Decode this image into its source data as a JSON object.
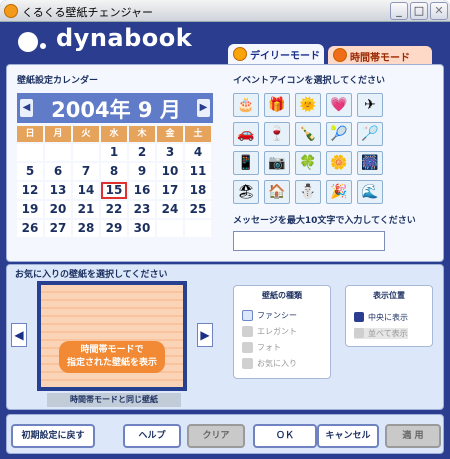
{
  "window": {
    "title": "くるくる壁紙チェンジャー",
    "controls": {
      "minimize": "_",
      "maximize": "□",
      "close": "✕"
    }
  },
  "header": {
    "brand": "dynabook"
  },
  "tabs": [
    {
      "label": "デイリーモード",
      "active": true
    },
    {
      "label": "時間帯モード",
      "active": false
    }
  ],
  "calendar": {
    "label": "壁紙設定カレンダー",
    "month_title": "2004年 9 月",
    "prev": "◀",
    "next": "▶",
    "weekdays": [
      "日",
      "月",
      "火",
      "水",
      "木",
      "金",
      "土"
    ],
    "weeks": [
      [
        "",
        "",
        "",
        "1",
        "2",
        "3",
        "4"
      ],
      [
        "5",
        "6",
        "7",
        "8",
        "9",
        "10",
        "11"
      ],
      [
        "12",
        "13",
        "14",
        "15",
        "16",
        "17",
        "18"
      ],
      [
        "19",
        "20",
        "21",
        "22",
        "23",
        "24",
        "25"
      ],
      [
        "26",
        "27",
        "28",
        "29",
        "30",
        "",
        ""
      ]
    ],
    "selected_day": "15"
  },
  "event_icons": {
    "label": "イベントアイコンを選択してください",
    "icons": [
      "🎂",
      "🎁",
      "🌞",
      "💗",
      "✈",
      "🚗",
      "🍷",
      "🍾",
      "🎾",
      "🏸",
      "📱",
      "📷",
      "🍀",
      "🌼",
      "🎆",
      "🏖",
      "🏠",
      "⛄",
      "🎉",
      "🌊"
    ]
  },
  "message": {
    "label": "メッセージを最大10文字で入力してください",
    "value": ""
  },
  "wallpaper": {
    "label": "お気に入りの壁紙を選択してください",
    "prev": "◀",
    "next": "▶",
    "preview_message": "時間帯モードで\n指定された壁紙を表示",
    "caption": "時間帯モードと同じ壁紙"
  },
  "wallpaper_type": {
    "title": "壁紙の種類",
    "options": [
      "ファンシー",
      "エレガント",
      "フォト",
      "お気に入り"
    ],
    "selected": "ファンシー"
  },
  "display_position": {
    "title": "表示位置",
    "options": [
      "中央に表示",
      "並べて表示"
    ],
    "selected": "中央に表示"
  },
  "buttons": {
    "reset": "初期設定に戻す",
    "help": "ヘルプ",
    "clear": "クリア",
    "ok": "ＯＫ",
    "cancel": "キャンセル",
    "apply": "適 用"
  }
}
